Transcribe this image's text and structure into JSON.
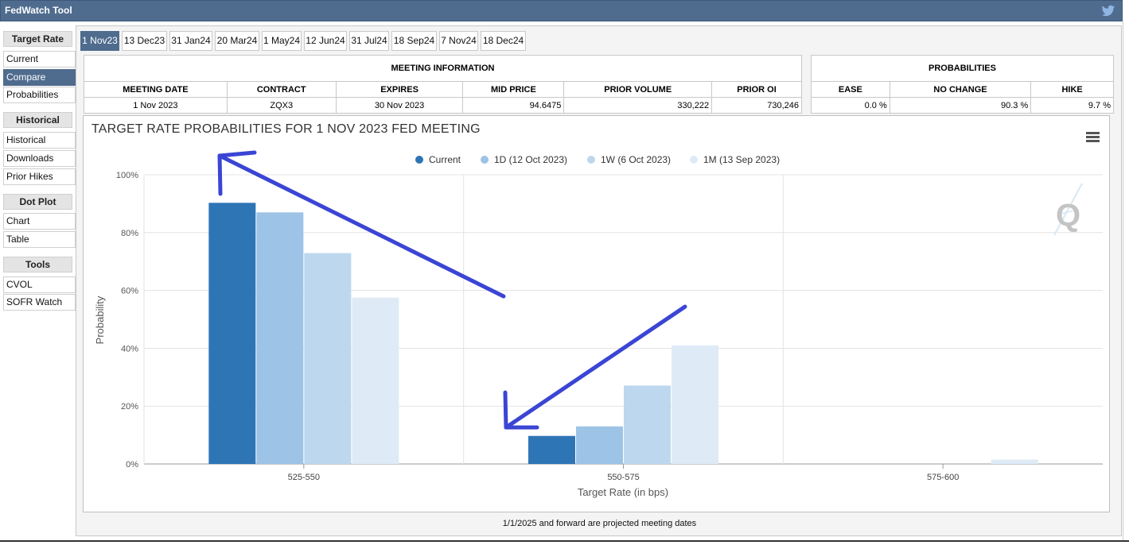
{
  "app": {
    "title": "FedWatch Tool",
    "social_icon": "twitter-icon"
  },
  "sidebar": {
    "sections": [
      {
        "heading": "Target Rate",
        "items": [
          "Current",
          "Compare",
          "Probabilities"
        ]
      },
      {
        "heading": "Historical",
        "items": [
          "Historical",
          "Downloads",
          "Prior Hikes"
        ]
      },
      {
        "heading": "Dot Plot",
        "items": [
          "Chart",
          "Table"
        ]
      },
      {
        "heading": "Tools",
        "items": [
          "CVOL",
          "SOFR Watch"
        ]
      }
    ],
    "active_item": "Compare"
  },
  "tabs": [
    "1 Nov23",
    "13 Dec23",
    "31 Jan24",
    "20 Mar24",
    "1 May24",
    "12 Jun24",
    "31 Jul24",
    "18 Sep24",
    "7 Nov24",
    "18 Dec24"
  ],
  "active_tab": "1 Nov23",
  "meeting_info": {
    "heading": "MEETING INFORMATION",
    "columns": [
      "MEETING DATE",
      "CONTRACT",
      "EXPIRES",
      "MID PRICE",
      "PRIOR VOLUME",
      "PRIOR OI"
    ],
    "row": [
      "1 Nov 2023",
      "ZQX3",
      "30 Nov 2023",
      "94.6475",
      "330,222",
      "730,246"
    ]
  },
  "probabilities": {
    "heading": "PROBABILITIES",
    "columns": [
      "EASE",
      "NO CHANGE",
      "HIKE"
    ],
    "row": [
      "0.0 %",
      "90.3 %",
      "9.7 %"
    ]
  },
  "chart_data": {
    "type": "bar",
    "title": "TARGET RATE PROBABILITIES FOR 1 NOV 2023 FED MEETING",
    "xlabel": "Target Rate (in bps)",
    "ylabel": "Probability",
    "categories": [
      "525-550",
      "550-575",
      "575-600"
    ],
    "series": [
      {
        "name": "Current",
        "color": "#2e75b6",
        "values": [
          90.3,
          9.7,
          0
        ]
      },
      {
        "name": "1D (12 Oct 2023)",
        "color": "#9dc3e6",
        "values": [
          87.0,
          13.0,
          0
        ]
      },
      {
        "name": "1W (6 Oct 2023)",
        "color": "#bdd7ee",
        "values": [
          72.9,
          27.1,
          0
        ]
      },
      {
        "name": "1M (13 Sep 2023)",
        "color": "#deebf7",
        "values": [
          57.5,
          41.0,
          1.5
        ]
      }
    ],
    "ylim": [
      0,
      100
    ],
    "yticks": [
      "0%",
      "20%",
      "40%",
      "60%",
      "80%",
      "100%"
    ],
    "grid": true,
    "legend_position": "top-center",
    "annotation_color": "#3b45d4"
  },
  "footer_note": "1/1/2025 and forward are projected meeting dates"
}
